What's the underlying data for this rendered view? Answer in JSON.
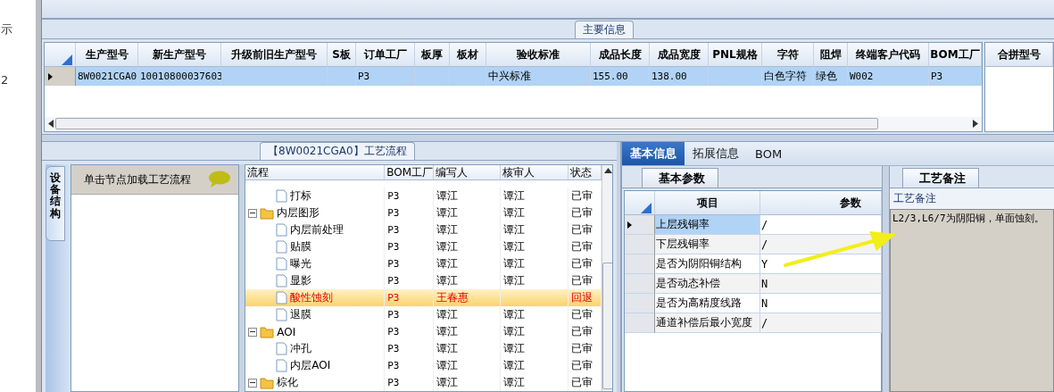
{
  "left_strip": [
    "示",
    "2"
  ],
  "main_info": {
    "title": "主要信息",
    "columns": [
      "生产型号",
      "新生产型号",
      "升级前旧生产型号",
      "S板",
      "订单工厂",
      "板厚",
      "板材",
      "验收标准",
      "成品长度",
      "成品宽度",
      "PNL规格",
      "字符",
      "阻焊",
      "终端客户代码",
      "BOM工厂"
    ],
    "rows": [
      {
        "selected": true,
        "cells": [
          "8W0021CGA0",
          "10010800037603",
          "",
          "",
          "P3",
          "",
          "",
          "中兴标准",
          "155.00",
          "138.00",
          "",
          "白色字符",
          "绿色",
          "W002",
          "P3"
        ]
      }
    ],
    "side_column": "合拼型号"
  },
  "process": {
    "title": "【8W0021CGA0】工艺流程",
    "side_tab": "设备结构",
    "hint": "单击节点加载工艺流程",
    "columns": [
      "流程",
      "BOM工厂",
      "编写人",
      "核审人",
      "状态"
    ],
    "tree": [
      {
        "kind": "continued",
        "children": [
          {
            "kind": "file",
            "label": "打标",
            "bom": "P3",
            "writer": "谭江",
            "reviewer": "谭江",
            "status": "已审",
            "selected": false,
            "rejected": false
          }
        ]
      },
      {
        "kind": "folder",
        "label": "内层图形",
        "bom": "P3",
        "writer": "谭江",
        "reviewer": "谭江",
        "status": "已审",
        "selected": false,
        "rejected": false,
        "expanded": true,
        "children": [
          {
            "kind": "file",
            "label": "内层前处理",
            "bom": "P3",
            "writer": "谭江",
            "reviewer": "谭江",
            "status": "已审",
            "selected": false,
            "rejected": false
          },
          {
            "kind": "file",
            "label": "贴膜",
            "bom": "P3",
            "writer": "谭江",
            "reviewer": "谭江",
            "status": "已审",
            "selected": false,
            "rejected": false
          },
          {
            "kind": "file",
            "label": "曝光",
            "bom": "P3",
            "writer": "谭江",
            "reviewer": "谭江",
            "status": "已审",
            "selected": false,
            "rejected": false
          },
          {
            "kind": "file",
            "label": "显影",
            "bom": "P3",
            "writer": "谭江",
            "reviewer": "谭江",
            "status": "已审",
            "selected": false,
            "rejected": false
          },
          {
            "kind": "file",
            "label": "酸性蚀刻",
            "bom": "P3",
            "writer": "王春惠",
            "status": "回退",
            "selected": true,
            "rejected": true
          },
          {
            "kind": "file",
            "label": "退膜",
            "bom": "P3",
            "writer": "谭江",
            "reviewer": "谭江",
            "status": "已审",
            "selected": false,
            "rejected": false
          }
        ]
      },
      {
        "kind": "folder",
        "label": "AOI",
        "bom": "P3",
        "writer": "谭江",
        "reviewer": "谭江",
        "status": "已审",
        "selected": false,
        "rejected": false,
        "expanded": true,
        "children": [
          {
            "kind": "file",
            "label": "冲孔",
            "bom": "P3",
            "writer": "谭江",
            "reviewer": "谭江",
            "status": "已审",
            "selected": false,
            "rejected": false
          },
          {
            "kind": "file",
            "label": "内层AOI",
            "bom": "P3",
            "writer": "谭江",
            "reviewer": "谭江",
            "status": "已审",
            "selected": false,
            "rejected": false
          }
        ]
      },
      {
        "kind": "folder",
        "label": "棕化",
        "bom": "P3",
        "writer": "谭江",
        "reviewer": "谭江",
        "status": "已审",
        "selected": false,
        "rejected": false,
        "expanded": true
      }
    ]
  },
  "detail_tabs": [
    {
      "label": "基本信息",
      "selected": true
    },
    {
      "label": "拓展信息",
      "selected": false
    },
    {
      "label": "BOM",
      "selected": false
    }
  ],
  "basic_params": {
    "title": "基本参数",
    "columns": [
      "项目",
      "参数"
    ],
    "rows": [
      {
        "item": "上层残铜率",
        "value": "/",
        "selected": true
      },
      {
        "item": "下层残铜率",
        "value": "/",
        "selected": false
      },
      {
        "item": "是否为阴阳铜结构",
        "value": "Y",
        "selected": false
      },
      {
        "item": "是否动态补偿",
        "value": "N",
        "selected": false
      },
      {
        "item": "是否为高精度线路",
        "value": "N",
        "selected": false
      },
      {
        "item": "通道补偿后最小宽度",
        "value": "/",
        "selected": false
      }
    ]
  },
  "process_notes": {
    "title": "工艺备注",
    "label": "工艺备注",
    "text": "L2/3,L6/7为阴阳铜，单面蚀刻。"
  }
}
